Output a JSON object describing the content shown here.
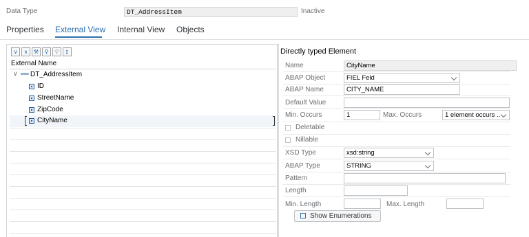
{
  "header": {
    "data_type_label": "Data Type",
    "data_type_value": "DT_AddressItem",
    "status": "Inactive"
  },
  "tabs": [
    "Properties",
    "External View",
    "Internal View",
    "Objects"
  ],
  "left_panel": {
    "column_header": "External Name",
    "toolbar_icons": [
      "expand-all-icon",
      "collapse-all-icon",
      "wrench-icon",
      "find-icon",
      "find-next-icon",
      "column-icon"
    ],
    "tree": {
      "root": "DT_AddressItem",
      "children": [
        "ID",
        "StreetName",
        "ZipCode",
        "CityName"
      ],
      "selected": "CityName"
    }
  },
  "right_panel": {
    "title": "Directly typed Element",
    "name_label": "Name",
    "name_value": "CityName",
    "abap_object_label": "ABAP Object",
    "abap_object_value": "FIEL Feld",
    "abap_name_label": "ABAP Name",
    "abap_name_value": "CITY_NAME",
    "default_value_label": "Default Value",
    "default_value": "",
    "min_occurs_label": "Min. Occurs",
    "min_occurs_value": "1",
    "max_occurs_label": "Max. Occurs",
    "max_occurs_value": "1 element occurs ..",
    "deletable_label": "Deletable",
    "deletable_checked": false,
    "nillable_label": "Nillable",
    "nillable_checked": false,
    "xsd_type_label": "XSD Type",
    "xsd_type_value": "xsd:string",
    "abap_type_label": "ABAP Type",
    "abap_type_value": "STRING",
    "pattern_label": "Pattern",
    "pattern_value": "",
    "length_label": "Length",
    "length_value": "",
    "min_length_label": "Min. Length",
    "min_length_value": "",
    "max_length_label": "Max. Length",
    "max_length_value": "",
    "show_enum_button": "Show Enumerations"
  }
}
